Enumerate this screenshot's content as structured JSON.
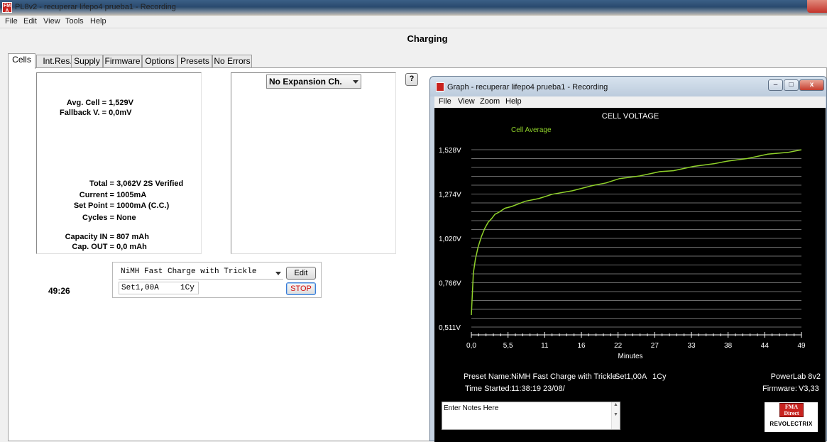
{
  "window": {
    "title": "PL8v2 - recuperar lifepo4 prueba1 - Recording",
    "icon": "fma-app-icon"
  },
  "menu": [
    "File",
    "Edit",
    "View",
    "Tools",
    "Help"
  ],
  "status": "Charging",
  "tabs": [
    "Cells",
    "Int.Res.",
    "Supply",
    "Firmware",
    "Options",
    "Presets",
    "No Errors"
  ],
  "cells": {
    "avg_cell_label": "Avg. Cell =",
    "avg_cell": "1,529V",
    "fallback_label": "Fallback V. =",
    "fallback": "0,0mV",
    "total_label": "Total =",
    "total": "3,062V  2S  Verified",
    "current_label": "Current =",
    "current": "1005mA",
    "setpoint_label": "Set Point =",
    "setpoint": "1000mA  (C.C.)",
    "cycles_label": "Cycles =",
    "cycles": "None",
    "capin_label": "Capacity IN =",
    "capin": "807 mAh",
    "capout_label": "Cap. OUT =",
    "capout": "0,0 mAh"
  },
  "expansion": {
    "selected": "No Expansion Ch."
  },
  "help_button": "?",
  "timer": "49:26",
  "preset": {
    "selected": "NiMH Fast Charge with Trickle",
    "edit_label": "Edit",
    "setting": "Set1,00A",
    "cycles": "1Cy",
    "stop_label": "STOP"
  },
  "graph": {
    "title": "Graph - recuperar lifepo4 prueba1 - Recording",
    "menu": [
      "File",
      "View",
      "Zoom",
      "Help"
    ],
    "window_buttons": {
      "minimize": "–",
      "restore": "□",
      "close": "x"
    },
    "preset_name_label": "Preset Name:",
    "preset_name": "NiMH Fast Charge with Trickle",
    "preset_setting": "Set1,00A",
    "preset_cycles": "1Cy",
    "time_started_label": "Time Started:",
    "time_started": "11:38:19  23/08/",
    "device": "PowerLab 8v2",
    "firmware_label": "Firmware:",
    "firmware": "V3,33",
    "notes_placeholder": "Enter Notes Here",
    "logo_top": "FMA Direct",
    "logo_bottom": "REVOLECTRIX"
  },
  "chart_data": {
    "type": "line",
    "title": "CELL VOLTAGE",
    "xlabel": "Minutes",
    "ylabel": "",
    "x_ticks": [
      "0,0",
      "5,5",
      "11",
      "16",
      "22",
      "27",
      "33",
      "38",
      "44",
      "49"
    ],
    "y_ticks": [
      "1,528V",
      "1,274V",
      "1,020V",
      "0,766V",
      "0,511V"
    ],
    "xlim": [
      0,
      49
    ],
    "ylim": [
      0.511,
      1.528
    ],
    "grid": true,
    "line_color": "#8fd12a",
    "series": [
      {
        "name": "Cell Average",
        "x": [
          0,
          0.3,
          0.6,
          1,
          1.5,
          2,
          2.5,
          3,
          3.5,
          4,
          5,
          6,
          8,
          10,
          12,
          15,
          18,
          20,
          22,
          25,
          28,
          30,
          33,
          36,
          38,
          41,
          44,
          47,
          49
        ],
        "y": [
          0.58,
          0.82,
          0.9,
          0.97,
          1.03,
          1.08,
          1.11,
          1.135,
          1.155,
          1.17,
          1.19,
          1.205,
          1.23,
          1.25,
          1.27,
          1.295,
          1.32,
          1.34,
          1.36,
          1.38,
          1.4,
          1.41,
          1.43,
          1.45,
          1.46,
          1.48,
          1.5,
          1.515,
          1.525
        ]
      }
    ]
  }
}
